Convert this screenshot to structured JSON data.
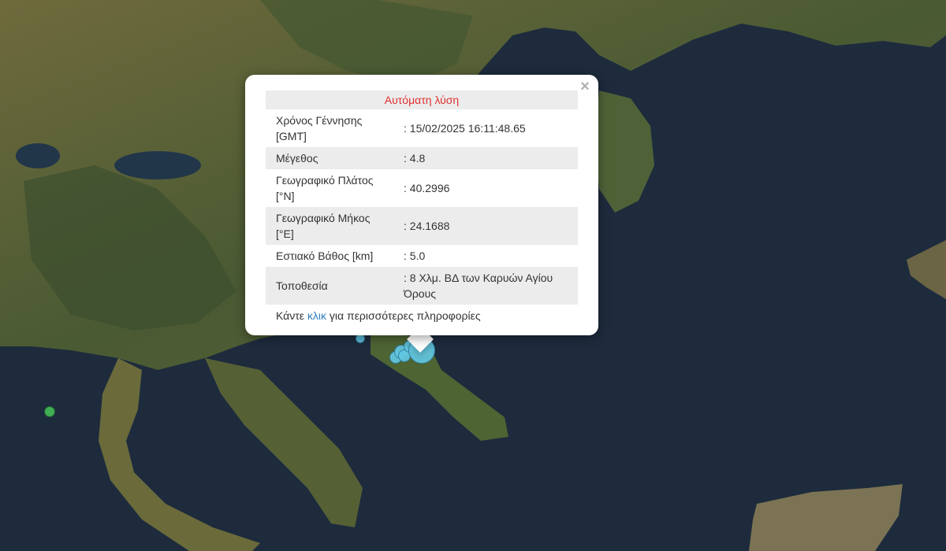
{
  "popup": {
    "title": "Αυτόματη λύση",
    "close_symbol": "×",
    "rows": [
      {
        "label": "Χρόνος Γέννησης [GMT]",
        "value": ": 15/02/2025 16:11:48.65"
      },
      {
        "label": "Μέγεθος",
        "value": ": 4.8"
      },
      {
        "label": "Γεωγραφικό Πλάτος [°N]",
        "value": ": 40.2996"
      },
      {
        "label": "Γεωγραφικό Μήκος [°E]",
        "value": ": 24.1688"
      },
      {
        "label": "Εστιακό Βάθος [km]",
        "value": ": 5.0"
      },
      {
        "label": "Τοποθεσία",
        "value": ": 8 Χλμ. ΒΔ των Καρυών Αγίου Όρους"
      }
    ],
    "footer_prefix": "Κάντε ",
    "footer_link": "κλικ",
    "footer_suffix": " για περισσότερες πληροφορίες"
  },
  "map": {
    "colors": {
      "sea": "#1d2b3d",
      "land_dark": "#3e5230",
      "land_light": "#76713f",
      "lake": "#22364a",
      "event_marker": "#63c7e2",
      "other_marker": "#3fae55",
      "title_red": "#e03030",
      "link_blue": "#2f7fc1"
    },
    "markers": [
      {
        "kind": "earthquake-event",
        "icon": "circle-marker"
      },
      {
        "kind": "earthquake-event",
        "icon": "circle-marker"
      },
      {
        "kind": "earthquake-event",
        "icon": "circle-marker"
      },
      {
        "kind": "earthquake-event",
        "icon": "circle-marker"
      },
      {
        "kind": "earthquake-event",
        "icon": "circle-marker"
      },
      {
        "kind": "earthquake-event",
        "icon": "circle-marker"
      },
      {
        "kind": "earthquake-event",
        "icon": "circle-marker"
      },
      {
        "kind": "other-event",
        "icon": "circle-marker"
      }
    ]
  }
}
